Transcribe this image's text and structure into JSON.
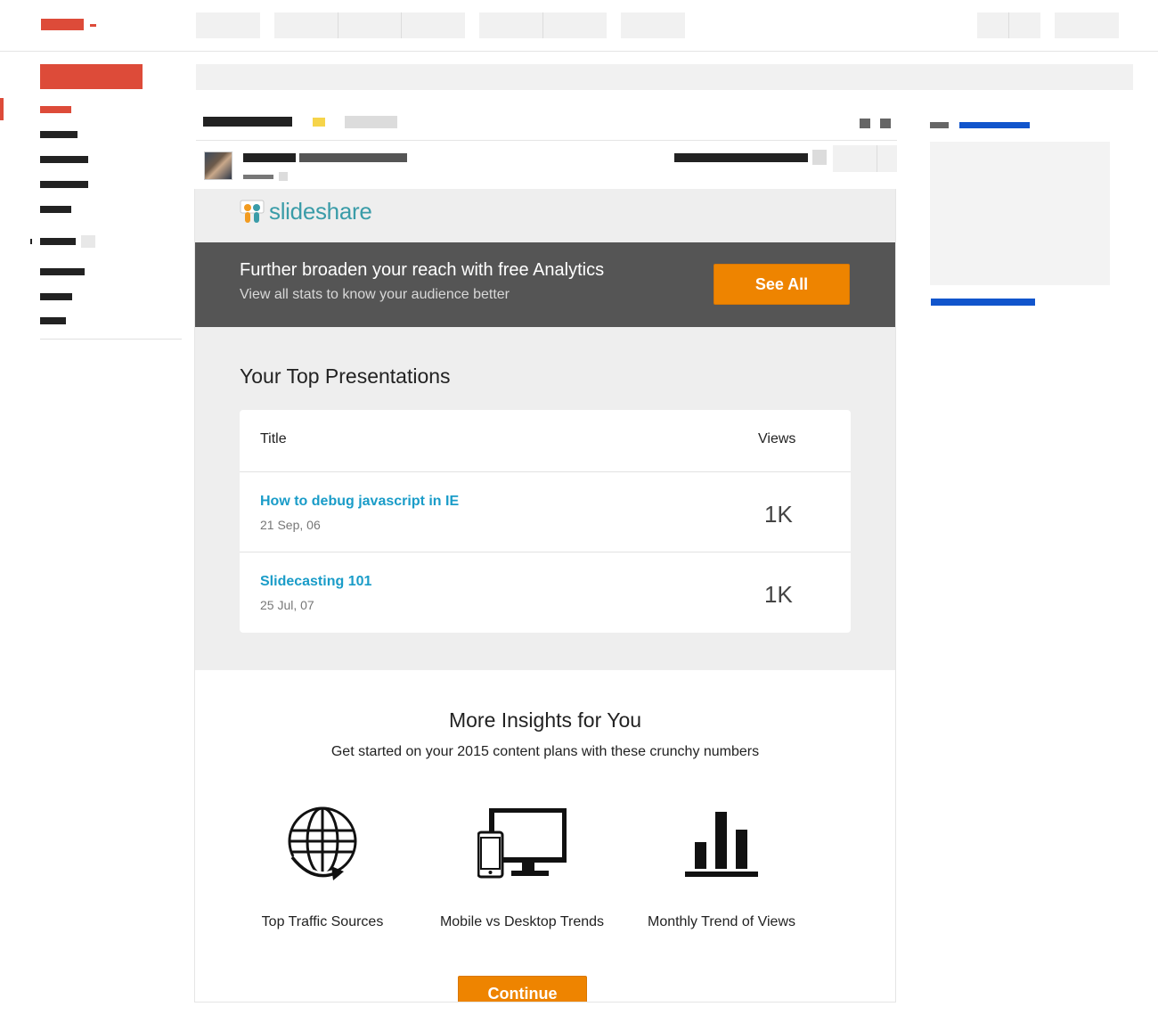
{
  "email": {
    "logo": {
      "part1": "slide",
      "part2": "share"
    },
    "banner": {
      "title": "Further broaden your reach with free Analytics",
      "subtitle": "View all stats to know your audience better",
      "button": "See All"
    },
    "top_presentations": {
      "heading": "Your Top Presentations",
      "col_title": "Title",
      "col_views": "Views",
      "rows": [
        {
          "title": "How to debug javascript in IE",
          "date": "21 Sep, 06",
          "views": "1K"
        },
        {
          "title": "Slidecasting 101",
          "date": "25 Jul, 07",
          "views": "1K"
        }
      ]
    },
    "insights": {
      "heading": "More Insights for You",
      "subheading": "Get started on your 2015 content plans with these crunchy numbers",
      "items": [
        {
          "label": "Top Traffic Sources",
          "icon": "globe-icon"
        },
        {
          "label": "Mobile vs Desktop Trends",
          "icon": "devices-icon"
        },
        {
          "label": "Monthly Trend of Views",
          "icon": "bar-chart-icon"
        }
      ],
      "button": "Continue"
    }
  },
  "colors": {
    "accent_orange": "#ee8400",
    "brand_red": "#dd4b39",
    "link_blue": "#1a9cc8",
    "banner_gray": "#555555"
  }
}
